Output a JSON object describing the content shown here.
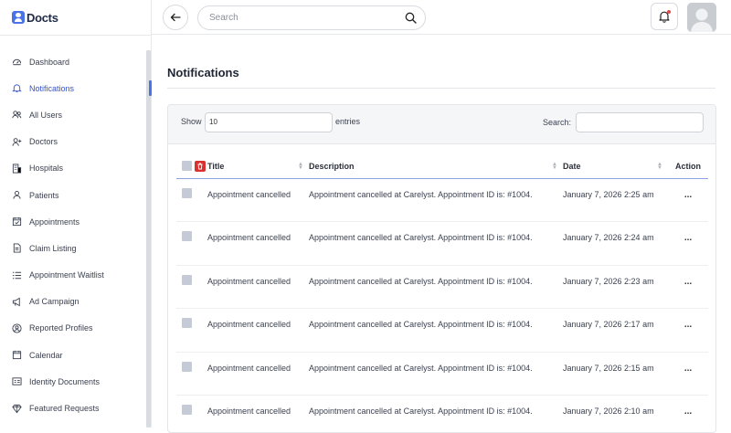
{
  "app": {
    "logo_text": "Docts"
  },
  "header": {
    "search_placeholder": "Search"
  },
  "sidebar": {
    "items": [
      {
        "label": "Dashboard",
        "icon": "dashboard-icon"
      },
      {
        "label": "Notifications",
        "icon": "bell-icon",
        "active": true
      },
      {
        "label": "All Users",
        "icon": "users-icon"
      },
      {
        "label": "Doctors",
        "icon": "user-plus-icon"
      },
      {
        "label": "Hospitals",
        "icon": "building-icon"
      },
      {
        "label": "Patients",
        "icon": "user-icon"
      },
      {
        "label": "Appointments",
        "icon": "calendar-check-icon"
      },
      {
        "label": "Claim Listing",
        "icon": "document-icon"
      },
      {
        "label": "Appointment Waitlist",
        "icon": "list-icon"
      },
      {
        "label": "Ad Campaign",
        "icon": "megaphone-icon"
      },
      {
        "label": "Reported Profiles",
        "icon": "user-circle-icon"
      },
      {
        "label": "Calendar",
        "icon": "calendar-icon"
      },
      {
        "label": "Identity Documents",
        "icon": "id-card-icon"
      },
      {
        "label": "Featured Requests",
        "icon": "diamond-icon"
      }
    ]
  },
  "main": {
    "title": "Notifications",
    "show_label": "Show",
    "page_size": "10",
    "entries_label": "entries",
    "search_label": "Search:",
    "columns": {
      "title": "Title",
      "description": "Description",
      "date": "Date",
      "action": "Action"
    },
    "rows": [
      {
        "title": "Appointment cancelled",
        "description": "Appointment cancelled at Carelyst. Appointment ID is: #1004.",
        "date": "January 7, 2026 2:25 am",
        "action": "..."
      },
      {
        "title": "Appointment cancelled",
        "description": "Appointment cancelled at Carelyst. Appointment ID is: #1004.",
        "date": "January 7, 2026 2:24 am",
        "action": "..."
      },
      {
        "title": "Appointment cancelled",
        "description": "Appointment cancelled at Carelyst. Appointment ID is: #1004.",
        "date": "January 7, 2026 2:23 am",
        "action": "..."
      },
      {
        "title": "Appointment cancelled",
        "description": "Appointment cancelled at Carelyst. Appointment ID is: #1004.",
        "date": "January 7, 2026 2:17 am",
        "action": "..."
      },
      {
        "title": "Appointment cancelled",
        "description": "Appointment cancelled at Carelyst. Appointment ID is: #1004.",
        "date": "January 7, 2026 2:15 am",
        "action": "..."
      },
      {
        "title": "Appointment cancelled",
        "description": "Appointment cancelled at Carelyst. Appointment ID is: #1004.",
        "date": "January 7, 2026 2:10 am",
        "action": "..."
      }
    ]
  },
  "colors": {
    "accent": "#3452c9",
    "delete": "#d93030",
    "notification_dot": "#e04848"
  }
}
